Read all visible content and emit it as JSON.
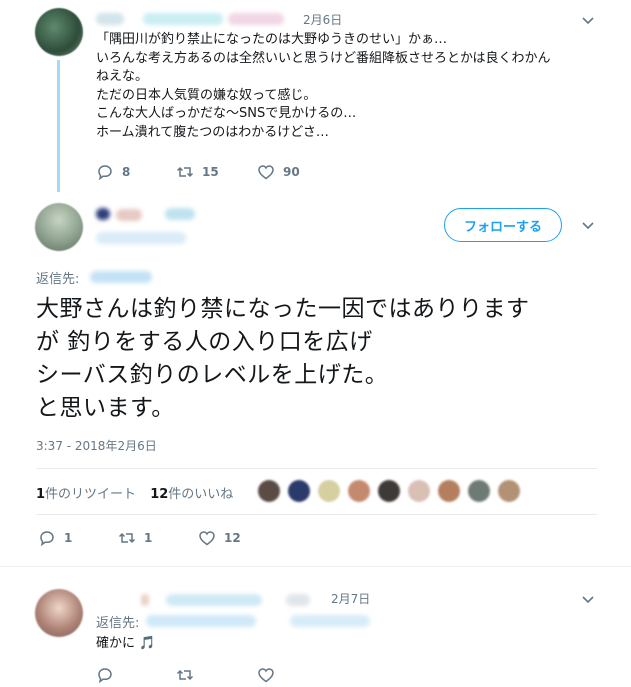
{
  "tweet1": {
    "date": "2月6日",
    "lines": [
      "「隅田川が釣り禁止になったのは大野ゆうきのせい」かぁ…",
      "いろんな考え方あるのは全然いいと思うけど番組降板させろとかは良くわかん",
      "ねえな。",
      "ただの日本人気質の嫌な奴って感じ。",
      "こんな大人ばっかだな〜SNSで見かけるの…",
      "ホーム潰れて腹たつのはわかるけどさ…"
    ],
    "reply_count": "8",
    "retweet_count": "15",
    "like_count": "90"
  },
  "main_tweet": {
    "follow_label": "フォローする",
    "reply_to_label": "返信先:",
    "text_lines": [
      "大野さんは釣り禁になった一因ではありります",
      "が 釣りをする人の入り口を広げ",
      "シーバス釣りのレベルを上げた。",
      "と思います。"
    ],
    "timestamp": "3:37 - 2018年2月6日",
    "retweets_num": "1",
    "retweets_label": "件のリツイート",
    "likes_num": "12",
    "likes_label": "件のいいね",
    "reply_count": "1",
    "retweet_count": "1",
    "like_count": "12"
  },
  "reply_tweet": {
    "date": "2月7日",
    "reply_to_label": "返信先:",
    "text": "確かに",
    "emoji": "🎵"
  },
  "colors": {
    "accent": "#1da1f2",
    "muted": "#657786",
    "thread_line": "#a4d9f9",
    "divider": "#e6ecf0"
  },
  "icons": [
    "reply-icon",
    "retweet-icon",
    "like-icon",
    "caret-down-icon",
    "music-note-icon"
  ]
}
